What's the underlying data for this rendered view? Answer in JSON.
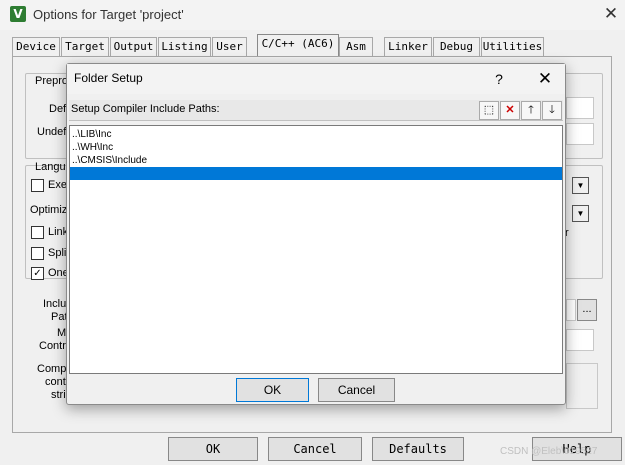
{
  "main_window": {
    "title": "Options for Target 'project'",
    "icon_letter": "V",
    "close_glyph": "✕"
  },
  "tabs": [
    {
      "label": "Device"
    },
    {
      "label": "Target"
    },
    {
      "label": "Output"
    },
    {
      "label": "Listing"
    },
    {
      "label": "User"
    },
    {
      "label": "C/C++ (AC6)",
      "active": true
    },
    {
      "label": "Asm"
    },
    {
      "label": "Linker"
    },
    {
      "label": "Debug"
    },
    {
      "label": "Utilities"
    }
  ],
  "background": {
    "preprocessor_group_label": "Prepro",
    "define_label": "Def",
    "undefine_label": "Undef",
    "language_group_label": "Langu",
    "execute_only_label": "Exe",
    "optimization_label": "Optimiz",
    "link_label": "Link",
    "split_label": "Spli",
    "one_label": "One",
    "include_paths_label_1": "Inclu",
    "include_paths_label_2": "Pat",
    "misc_label_1": "M",
    "misc_label_2": "Contro",
    "compiler_label_1": "Comp",
    "compiler_label_2": "cont",
    "compiler_label_3": "stri",
    "right_fragment": "r",
    "browse_label": "...",
    "check_mark": "✓"
  },
  "bottom_buttons": {
    "ok": "OK",
    "cancel": "Cancel",
    "defaults": "Defaults",
    "help": "Help"
  },
  "watermark": "CSDN @Eleb\\019527",
  "folder_setup": {
    "title": "Folder Setup",
    "help_glyph": "?",
    "close_glyph": "✕",
    "header_label": "Setup Compiler Include Paths:",
    "header_buttons": {
      "new": "⬚",
      "delete": "✕",
      "up": "🡑",
      "down": "🡓"
    },
    "paths": [
      "..\\LIB\\Inc",
      "..\\WH\\Inc",
      "..\\CMSIS\\Include",
      ""
    ],
    "selected_index": 3,
    "ok": "OK",
    "cancel": "Cancel"
  }
}
